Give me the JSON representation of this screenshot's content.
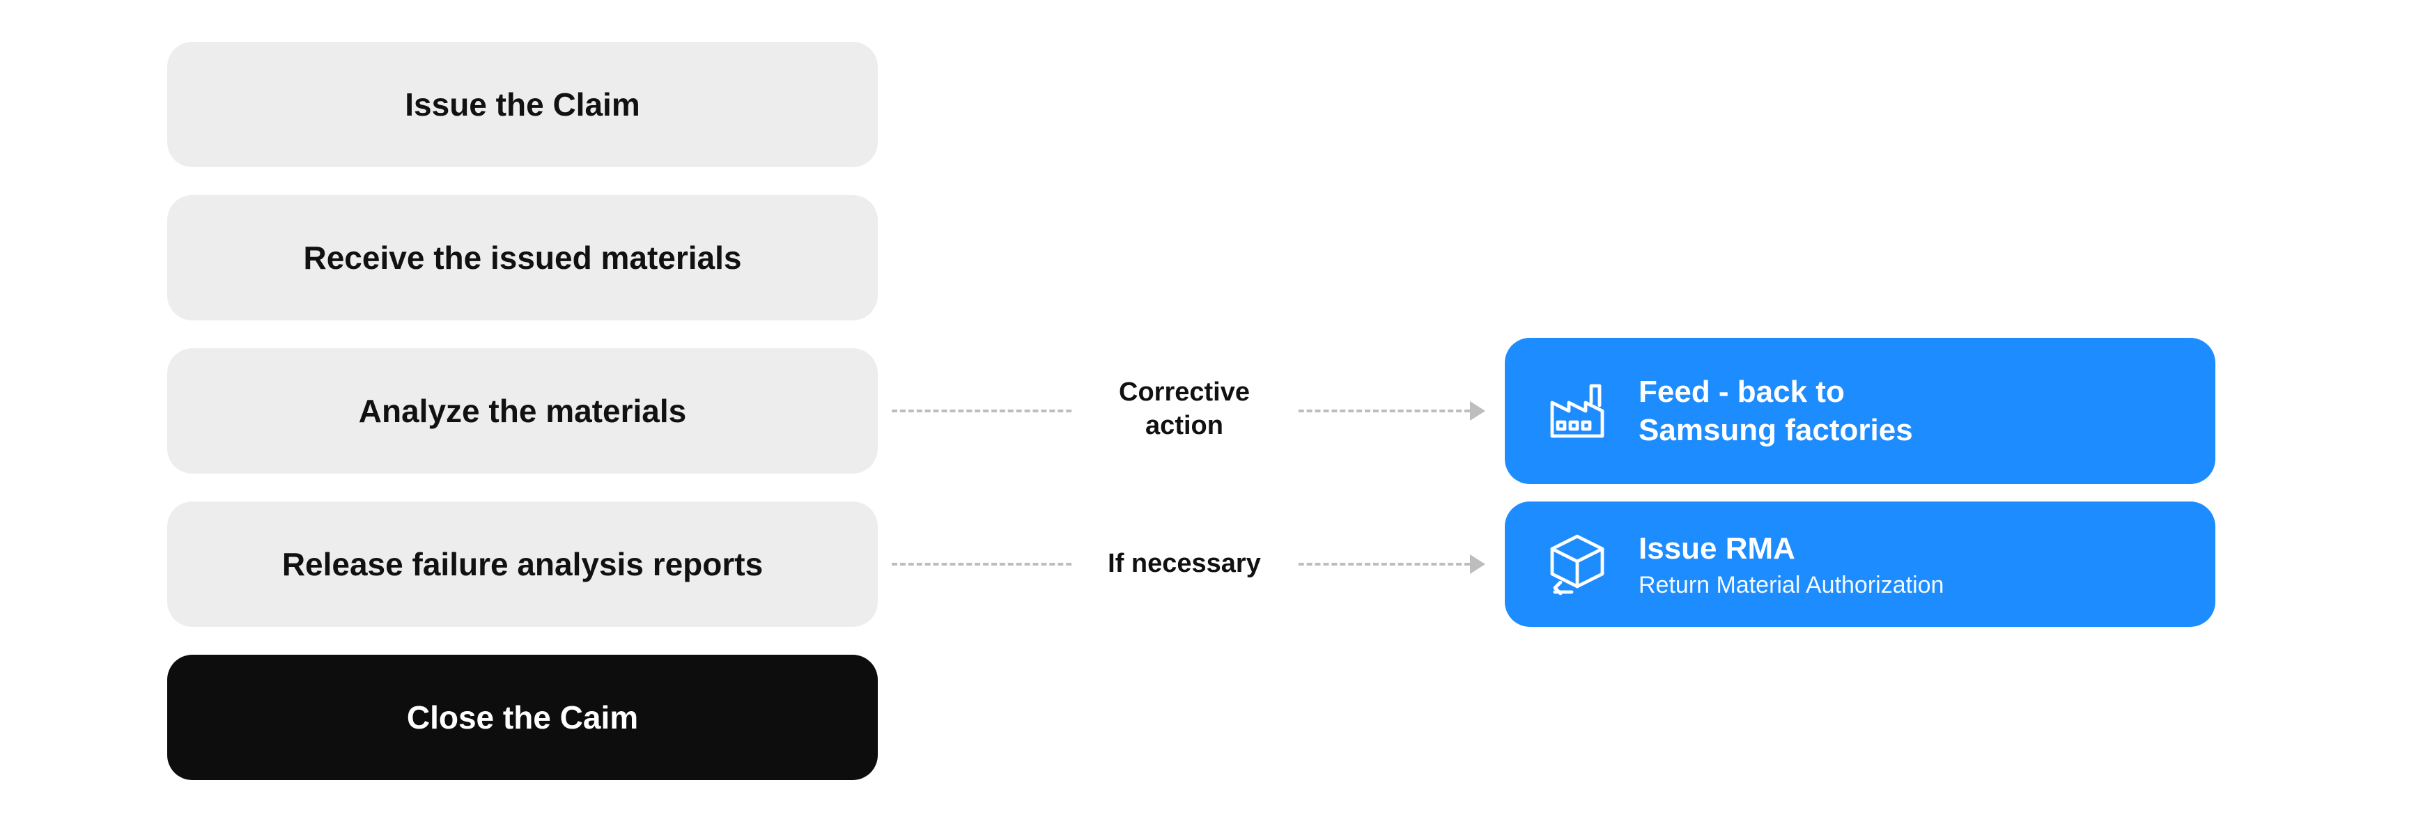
{
  "steps": [
    {
      "label": "Issue the Claim",
      "variant": "gray"
    },
    {
      "label": "Receive the issued materials",
      "variant": "gray"
    },
    {
      "label": "Analyze the materials",
      "variant": "gray"
    },
    {
      "label": "Release failure analysis reports",
      "variant": "gray"
    },
    {
      "label": "Close the Caim",
      "variant": "black"
    }
  ],
  "connectors": [
    {
      "label": "Corrective\naction"
    },
    {
      "label": "If necessary"
    }
  ],
  "outcomes": [
    {
      "icon": "factory-icon",
      "title": "Feed - back to\nSamsung factories",
      "sub": ""
    },
    {
      "icon": "box-return-icon",
      "title": "Issue RMA",
      "sub": "Return Material Authorization"
    }
  ]
}
